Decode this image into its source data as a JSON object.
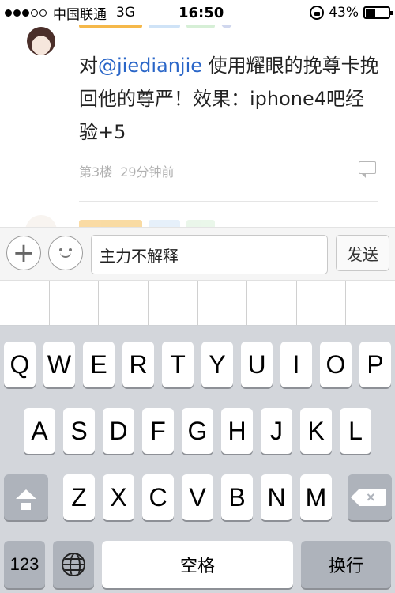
{
  "status_bar": {
    "carrier": "中国联通",
    "network": "3G",
    "time": "16:50",
    "battery_percent": "43%",
    "battery_level": 0.43
  },
  "post": {
    "content_prefix": "对",
    "mention": "@jiedianjie",
    "content_body": " 使用耀眼的挽尊卡挽回他的尊严！效果：iphone4吧经验+5",
    "floor": "第3楼",
    "time_ago": "29分钟前"
  },
  "input_bar": {
    "text_value": "主力不解释",
    "send_label": "发送"
  },
  "keyboard": {
    "row1": [
      "Q",
      "W",
      "E",
      "R",
      "T",
      "Y",
      "U",
      "I",
      "O",
      "P"
    ],
    "row2": [
      "A",
      "S",
      "D",
      "F",
      "G",
      "H",
      "J",
      "K",
      "L"
    ],
    "row3": [
      "Z",
      "X",
      "C",
      "V",
      "B",
      "N",
      "M"
    ],
    "numbers_label": "123",
    "space_label": "空格",
    "return_label": "换行"
  },
  "icons": {
    "plus": "plus-icon",
    "emoji": "emoji-icon",
    "shift": "shift-icon",
    "delete": "backspace-icon",
    "globe": "globe-icon",
    "comment": "comment-icon",
    "lock": "orientation-lock-icon",
    "battery": "battery-icon"
  }
}
